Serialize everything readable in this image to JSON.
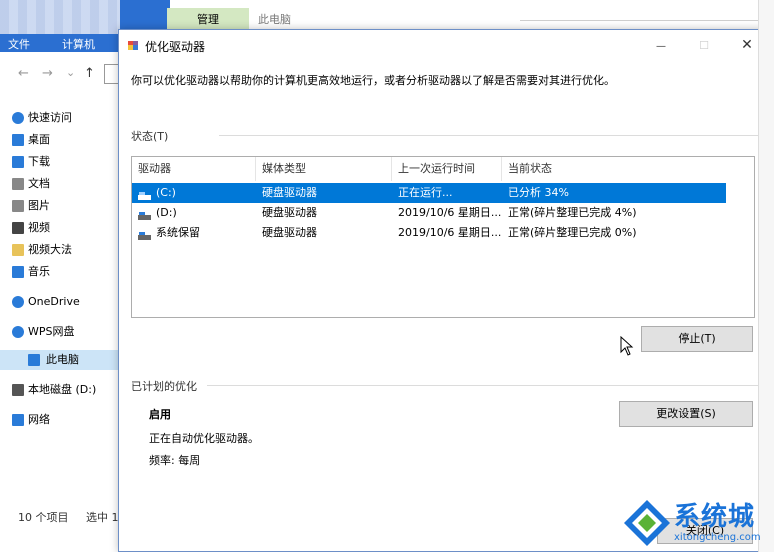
{
  "explorer": {
    "tabs": {
      "file": "文件",
      "computer": "计算机",
      "manage": "管理",
      "this_pc": "此电脑"
    },
    "nav": {
      "back": "←",
      "forward": "→",
      "dropdown": "⌄",
      "up": "↑"
    },
    "sidebar": [
      {
        "label": "快速访问",
        "icon": "star-icon",
        "color": "#2a7bd8"
      },
      {
        "label": "桌面",
        "icon": "desktop-icon",
        "color": "#2a7bd8"
      },
      {
        "label": "下载",
        "icon": "download-icon",
        "color": "#2a7bd8"
      },
      {
        "label": "文档",
        "icon": "document-icon",
        "color": "#888888"
      },
      {
        "label": "图片",
        "icon": "picture-icon",
        "color": "#888888"
      },
      {
        "label": "视频",
        "icon": "video-icon",
        "color": "#444444"
      },
      {
        "label": "视频大法",
        "icon": "folder-icon",
        "color": "#e8c35a"
      },
      {
        "label": "音乐",
        "icon": "music-icon",
        "color": "#2a7bd8"
      },
      {
        "label": "OneDrive",
        "icon": "cloud-icon",
        "color": "#2a7bd8"
      },
      {
        "label": "WPS网盘",
        "icon": "cloud-outline-icon",
        "color": "#2a7bd8"
      },
      {
        "label": "此电脑",
        "icon": "computer-icon",
        "color": "#2a7bd8"
      },
      {
        "label": "本地磁盘 (D:)",
        "icon": "disk-icon",
        "color": "#555555"
      },
      {
        "label": "网络",
        "icon": "network-icon",
        "color": "#2a7bd8"
      }
    ],
    "status": {
      "items": "10 个项目",
      "selected": "选中 1"
    }
  },
  "dialog": {
    "title": "优化驱动器",
    "controls": {
      "minimize": "—",
      "maximize": "☐",
      "close": "✕"
    },
    "description": "你可以优化驱动器以帮助你的计算机更高效地运行，或者分析驱动器以了解是否需要对其进行优化。",
    "status_label": "状态(T)",
    "columns": [
      "驱动器",
      "媒体类型",
      "上一次运行时间",
      "当前状态"
    ],
    "drives": [
      {
        "name": "(C:)",
        "media": "硬盘驱动器",
        "last_run": "正在运行...",
        "status": "已分析 34%",
        "selected": true
      },
      {
        "name": "(D:)",
        "media": "硬盘驱动器",
        "last_run": "2019/10/6 星期日...",
        "status": "正常(碎片整理已完成 4%)",
        "selected": false
      },
      {
        "name": "系统保留",
        "media": "硬盘驱动器",
        "last_run": "2019/10/6 星期日...",
        "status": "正常(碎片整理已完成 0%)",
        "selected": false
      }
    ],
    "stop_button": "停止(T)",
    "scheduled_label": "已计划的优化",
    "scheduled_state": "启用",
    "scheduled_desc": "正在自动优化驱动器。",
    "frequency": "频率: 每周",
    "change_settings_button": "更改设置(S)",
    "close_button": "关闭(C)"
  },
  "watermark": {
    "name": "系统城",
    "url": "xitongcheng.com"
  },
  "colors": {
    "selection": "#0078d7",
    "accent": "#2b6fd1",
    "manage_tab": "#d4e8c2"
  }
}
